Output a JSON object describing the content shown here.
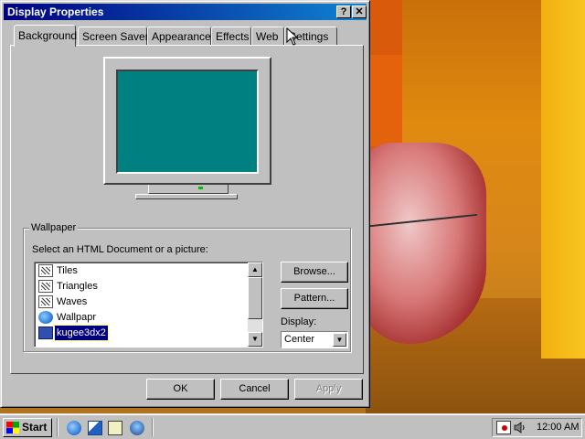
{
  "dialog": {
    "title": "Display Properties",
    "help_glyph": "?",
    "close_glyph": "✕"
  },
  "tabs": [
    {
      "label": "Background",
      "active": true
    },
    {
      "label": "Screen Saver"
    },
    {
      "label": "Appearance"
    },
    {
      "label": "Effects"
    },
    {
      "label": "Web"
    },
    {
      "label": "Settings"
    }
  ],
  "wallpaper": {
    "group_label": "Wallpaper",
    "select_label": "Select an HTML Document or a picture:",
    "items": [
      {
        "label": "Tiles",
        "icon": "bitmap-icon"
      },
      {
        "label": "Triangles",
        "icon": "bitmap-icon"
      },
      {
        "label": "Waves",
        "icon": "bitmap-icon"
      },
      {
        "label": "Wallpapr",
        "icon": "html-document-icon"
      },
      {
        "label": "kugee3dx2",
        "icon": "image-file-icon",
        "selected": true
      }
    ],
    "browse_label": "Browse...",
    "pattern_label": "Pattern...",
    "display_label": "Display:",
    "display_value": "Center"
  },
  "buttons": {
    "ok": "OK",
    "cancel": "Cancel",
    "apply": "Apply"
  },
  "taskbar": {
    "start_label": "Start",
    "clock": "12:00 AM"
  },
  "colors": {
    "title_active": "#000080",
    "monitor_screen": "#008080",
    "face": "#c0c0c0",
    "selection": "#000080"
  }
}
